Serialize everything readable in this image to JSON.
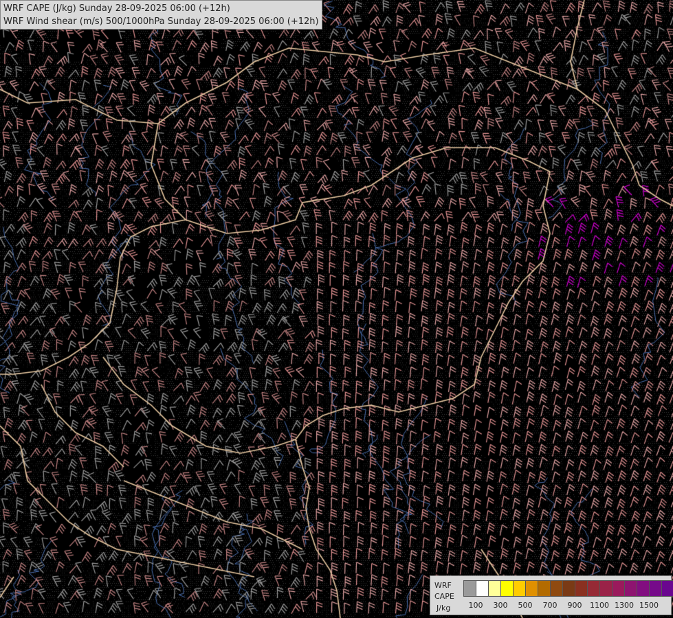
{
  "header": {
    "line1": "WRF CAPE (J/kg) Sunday 28-09-2025 06:00 (+12h)",
    "line2": "WRF Wind shear (m/s) 500/1000hPa Sunday 28-09-2025 06:00 (+12h)"
  },
  "legend": {
    "model": "WRF",
    "parameter": "CAPE",
    "unit": "J/kg",
    "colors": [
      "#9a9a9a",
      "#ffffff",
      "#ffff99",
      "#ffff00",
      "#ffcc00",
      "#e09000",
      "#b36b00",
      "#8f4a10",
      "#7a3a15",
      "#8a3020",
      "#962a35",
      "#9a2248",
      "#9a1a5c",
      "#8e1470",
      "#820e80",
      "#760a8a",
      "#6a068f"
    ],
    "tick_labels": [
      "100",
      "300",
      "500",
      "700",
      "900",
      "1100",
      "1300",
      "1500"
    ]
  },
  "map": {
    "background_color": "#000000",
    "border_color": "#e8c8a0",
    "river_color": "#4a6fb0",
    "barb_colors": [
      "#9a9a9a",
      "#c08080",
      "#e09090",
      "#e0a0a0",
      "#d080b0"
    ],
    "cape_highlight_color": "#d000d0"
  }
}
